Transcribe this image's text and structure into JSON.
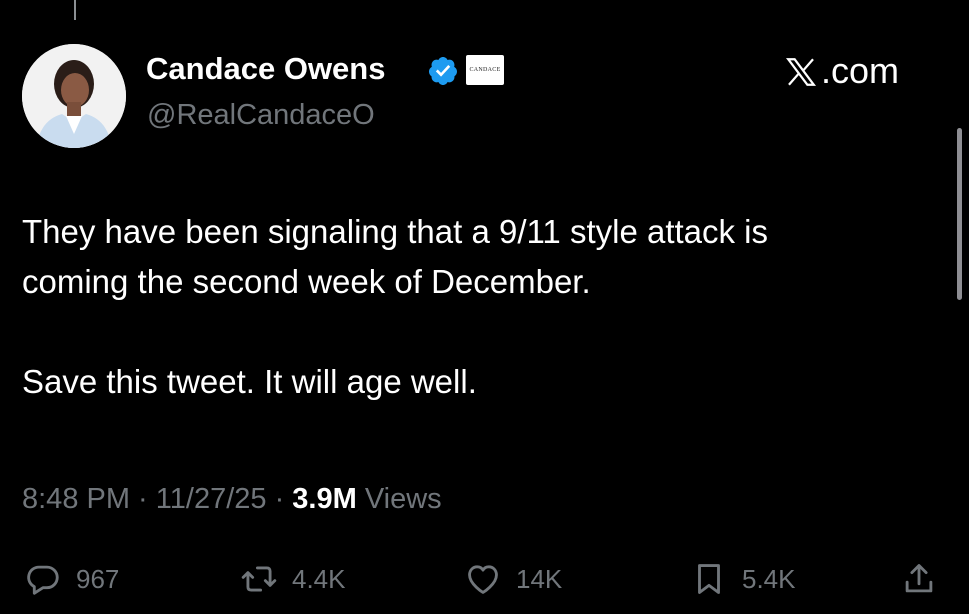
{
  "author": {
    "display_name": "Candace Owens",
    "handle": "@RealCandaceO",
    "affiliate_label": "CANDACE",
    "verified_icon": "verified-badge-icon"
  },
  "site": {
    "label": ".com"
  },
  "tweet": {
    "lines": [
      "They have been signaling that a 9/11 style attack is",
      "coming the second week of December.",
      "Save this tweet. It will age well."
    ]
  },
  "meta": {
    "time": "8:48 PM",
    "separator1": " · ",
    "date": "11/27/25",
    "separator2": " · ",
    "views_count": "3.9M",
    "views_label": " Views"
  },
  "actions": {
    "replies": "967",
    "reposts": "4.4K",
    "likes": "14K",
    "bookmarks": "5.4K"
  },
  "colors": {
    "background": "#000000",
    "text": "#ffffff",
    "muted": "#71767b",
    "verified": "#1d9bf0"
  }
}
